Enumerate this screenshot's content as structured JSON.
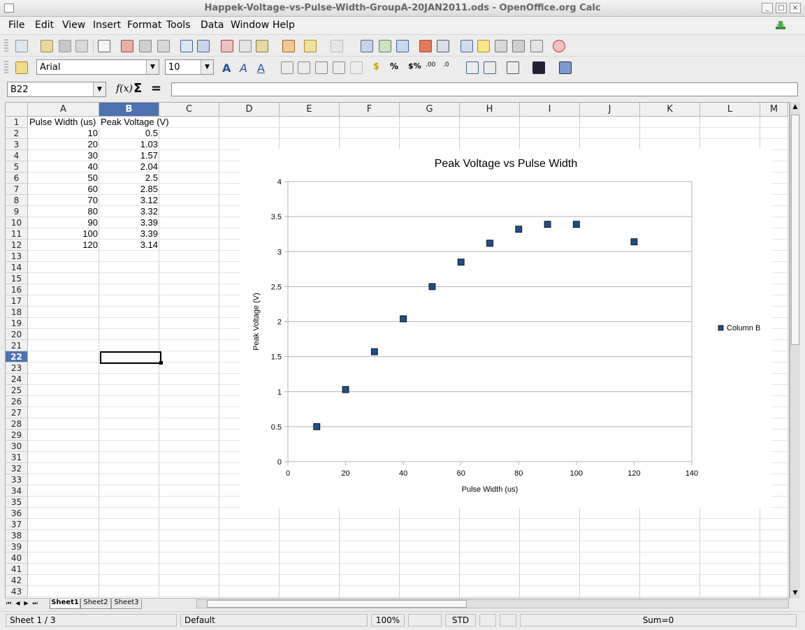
{
  "window": {
    "title": "Happek-Voltage-vs-Pulse-Width-GroupA-20JAN2011.ods - OpenOffice.org Calc"
  },
  "menu": [
    "File",
    "Edit",
    "View",
    "Insert",
    "Format",
    "Tools",
    "Data",
    "Window",
    "Help"
  ],
  "formatting": {
    "font_name": "Arial",
    "font_size": "10"
  },
  "formula": {
    "cell_ref": "B22",
    "content": ""
  },
  "columns": [
    "A",
    "B",
    "C",
    "D",
    "E",
    "F",
    "G",
    "H",
    "I",
    "J",
    "K",
    "L",
    "M"
  ],
  "selected_column": "B",
  "selected_row": 22,
  "rows_visible": 43,
  "cells": {
    "header": [
      "Pulse Width (us)",
      "Peak Voltage (V)"
    ],
    "data": [
      [
        "10",
        "0.5"
      ],
      [
        "20",
        "1.03"
      ],
      [
        "30",
        "1.57"
      ],
      [
        "40",
        "2.04"
      ],
      [
        "50",
        "2.5"
      ],
      [
        "60",
        "2.85"
      ],
      [
        "70",
        "3.12"
      ],
      [
        "80",
        "3.32"
      ],
      [
        "90",
        "3.39"
      ],
      [
        "100",
        "3.39"
      ],
      [
        "120",
        "3.14"
      ]
    ]
  },
  "sheets": [
    "Sheet1",
    "Sheet2",
    "Sheet3"
  ],
  "active_sheet": "Sheet1",
  "status": {
    "sheet": "Sheet 1 / 3",
    "style": "Default",
    "zoom": "100%",
    "mode": "STD",
    "sum": "Sum=0"
  },
  "colors": {
    "marker": "#1f4e8c",
    "selection": "#4e72b0"
  },
  "chart_data": {
    "type": "scatter",
    "title": "Peak Voltage vs Pulse Width",
    "xlabel": "Pulse Width (us)",
    "ylabel": "Peak Voltage (V)",
    "xlim": [
      0,
      140
    ],
    "ylim": [
      0,
      4
    ],
    "x_ticks": [
      0,
      20,
      40,
      60,
      80,
      100,
      120,
      140
    ],
    "y_ticks": [
      0,
      0.5,
      1,
      1.5,
      2,
      2.5,
      3,
      3.5,
      4
    ],
    "grid": "horizontal",
    "legend": "right",
    "series": [
      {
        "name": "Column B",
        "x": [
          10,
          20,
          30,
          40,
          50,
          60,
          70,
          80,
          90,
          100,
          120
        ],
        "y": [
          0.5,
          1.03,
          1.57,
          2.04,
          2.5,
          2.85,
          3.12,
          3.32,
          3.39,
          3.39,
          3.14
        ]
      }
    ]
  }
}
